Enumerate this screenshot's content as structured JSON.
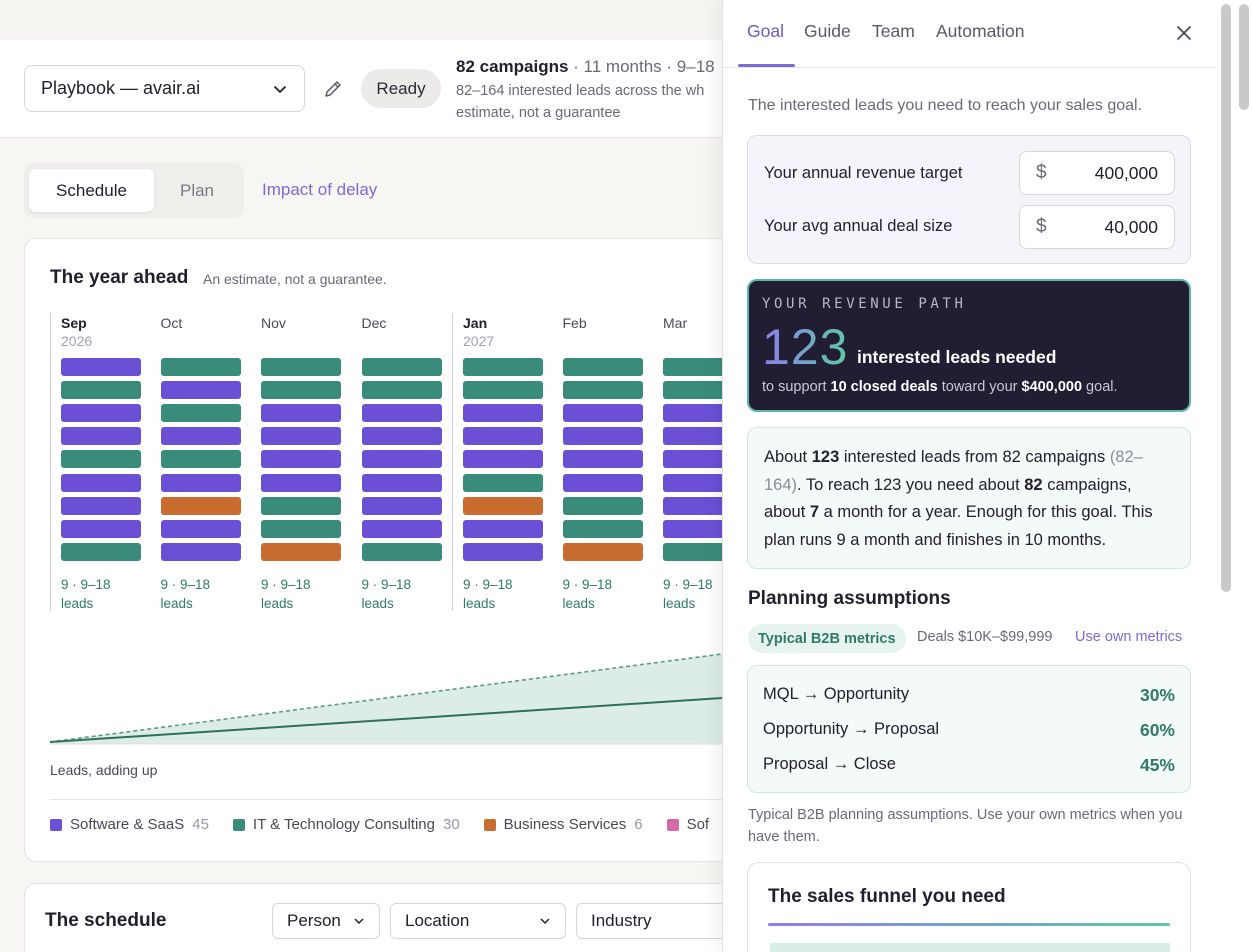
{
  "topbar": {
    "playbook_select": "Playbook — avair.ai",
    "status": "Ready",
    "campaigns_bold": "82 campaigns",
    "campaigns_rest": " · 11 months · 9–18",
    "campaigns_sub": "82–164 interested leads across the wh estimate, not a guarantee"
  },
  "view_tabs": {
    "schedule": "Schedule",
    "plan": "Plan",
    "impact": "Impact of delay"
  },
  "year_ahead": {
    "title": "The year ahead",
    "subtitle": "An estimate, not a guarantee.",
    "months": [
      {
        "name": "Sep",
        "year": "2026",
        "bold": true,
        "sep": true,
        "foot1": "9 · 9–18",
        "foot2": "leads",
        "bars": [
          "p",
          "g",
          "p",
          "p",
          "g",
          "p",
          "p",
          "p",
          "g"
        ]
      },
      {
        "name": "Oct",
        "year": "",
        "bold": false,
        "sep": false,
        "foot1": "9 · 9–18",
        "foot2": "leads",
        "bars": [
          "g",
          "p",
          "g",
          "p",
          "g",
          "p",
          "o",
          "p",
          "p"
        ]
      },
      {
        "name": "Nov",
        "year": "",
        "bold": false,
        "sep": false,
        "foot1": "9 · 9–18",
        "foot2": "leads",
        "bars": [
          "g",
          "g",
          "p",
          "p",
          "p",
          "p",
          "g",
          "g",
          "o"
        ]
      },
      {
        "name": "Dec",
        "year": "",
        "bold": false,
        "sep": false,
        "foot1": "9 · 9–18",
        "foot2": "leads",
        "bars": [
          "g",
          "g",
          "p",
          "p",
          "p",
          "p",
          "p",
          "p",
          "g"
        ]
      },
      {
        "name": "Jan",
        "year": "2027",
        "bold": true,
        "sep": true,
        "foot1": "9 · 9–18",
        "foot2": "leads",
        "bars": [
          "g",
          "g",
          "p",
          "p",
          "p",
          "g",
          "o",
          "p",
          "p"
        ]
      },
      {
        "name": "Feb",
        "year": "",
        "bold": false,
        "sep": false,
        "foot1": "9 · 9–18",
        "foot2": "leads",
        "bars": [
          "g",
          "g",
          "p",
          "p",
          "p",
          "p",
          "g",
          "g",
          "o"
        ]
      },
      {
        "name": "Mar",
        "year": "",
        "bold": false,
        "sep": false,
        "foot1": "9 · 9–18",
        "foot2": "leads",
        "bars": [
          "g",
          "g",
          "p",
          "p",
          "p",
          "p",
          "p",
          "p",
          "g"
        ]
      }
    ],
    "chart_caption": "Leads, adding up",
    "legend": [
      {
        "label": "Software & SaaS",
        "count": "45",
        "color": "#6b50d6"
      },
      {
        "label": "IT & Technology Consulting",
        "count": "30",
        "color": "#3a8c7a"
      },
      {
        "label": "Business Services",
        "count": "6",
        "color": "#c96c30"
      },
      {
        "label": "Sof",
        "count": "",
        "color": "#d66aa6"
      }
    ]
  },
  "colors": {
    "p": "#6b50d6",
    "g": "#3a8c7a",
    "o": "#c96c30"
  },
  "schedule": {
    "title": "The schedule",
    "filters": [
      "Person",
      "Location",
      "Industry"
    ]
  },
  "panel": {
    "tabs": [
      "Goal",
      "Guide",
      "Team",
      "Automation"
    ],
    "intro": "The interested leads you need to reach your sales goal.",
    "revenue_label": "Your annual revenue target",
    "revenue_currency": "$",
    "revenue_value": "400,000",
    "deal_label": "Your avg annual deal size",
    "deal_currency": "$",
    "deal_value": "40,000",
    "path_caption": "YOUR REVENUE PATH",
    "path_number": "123",
    "path_label": "interested leads needed",
    "path_sub_1": "to support ",
    "path_sub_bold1": "10 closed deals",
    "path_sub_2": " toward your ",
    "path_sub_bold2": "$400,000",
    "path_sub_3": " goal.",
    "about_1": "About ",
    "about_b1": "123",
    "about_2": " interested leads from 82 campaigns ",
    "about_range": "(82–164)",
    "about_3": ". To reach 123 you need about ",
    "about_b2": "82",
    "about_4": " campaigns, about ",
    "about_b3": "7",
    "about_5": " a month for a year. Enough for this goal. This plan runs 9 a month and finishes in 10 months.",
    "assumptions_title": "Planning assumptions",
    "assumptions_chip": "Typical B2B metrics",
    "assumptions_deals": "Deals $10K–$99,999",
    "assumptions_own": "Use own metrics",
    "rates": [
      {
        "label": "MQL → Opportunity",
        "value": "30%"
      },
      {
        "label": "Opportunity → Proposal",
        "value": "60%"
      },
      {
        "label": "Proposal → Close",
        "value": "45%"
      }
    ],
    "assumptions_note": "Typical B2B planning assumptions. Use your own metrics when you have them.",
    "funnel_title": "The sales funnel you need"
  }
}
